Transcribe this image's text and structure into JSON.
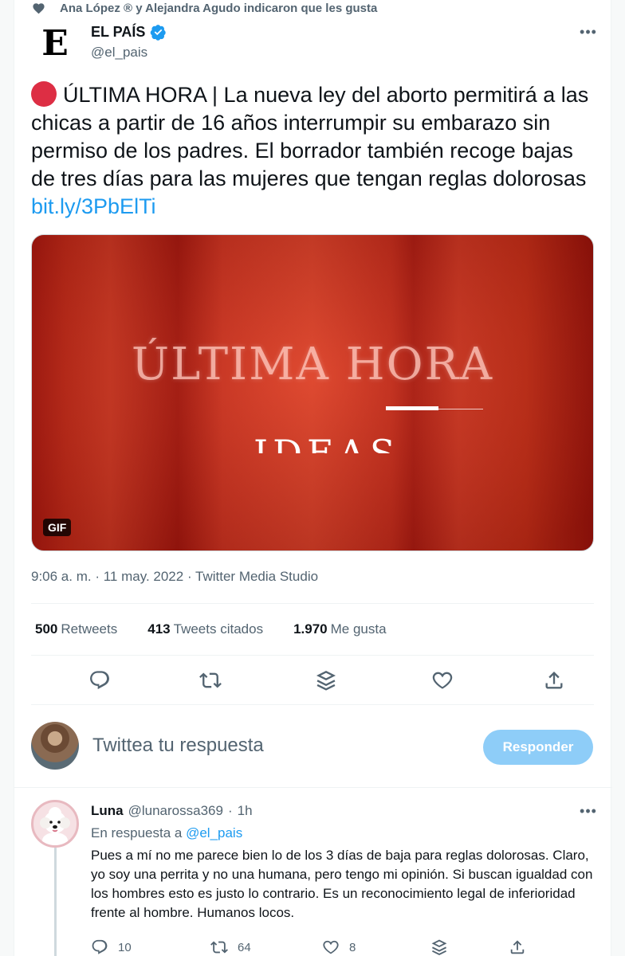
{
  "social_context": {
    "text": "Ana López ® y Alejandra Agudo indicaron que les gusta"
  },
  "tweet": {
    "avatar_letter": "E",
    "author_name": "EL PAÍS",
    "author_handle": "@el_pais",
    "more_icon": "•••",
    "text": "ÚLTIMA HORA | La nueva ley del aborto permitirá a las chicas a partir de 16 años interrumpir su embarazo sin permiso de los padres. El borrador también recoge bajas de tres días para las mujeres que tengan reglas dolorosas ",
    "link": "bit.ly/3PbElTi",
    "media": {
      "title": "ÚLTIMA HORA",
      "subtitle_fragment": "IDEAS",
      "badge": "GIF"
    },
    "time": "9:06 a. m.",
    "date": "11 may. 2022",
    "source": "Twitter Media Studio",
    "separator": " · "
  },
  "stats": {
    "retweets_count": "500",
    "retweets_label": "Retweets",
    "quotes_count": "413",
    "quotes_label": "Tweets citados",
    "likes_count": "1.970",
    "likes_label": "Me gusta"
  },
  "reply_box": {
    "placeholder": "Twittea tu respuesta",
    "button": "Responder"
  },
  "reply": {
    "name": "Luna",
    "handle": "@lunarossa369",
    "separator": "·",
    "time": "1h",
    "more_icon": "•••",
    "reply_prefix": "En respuesta a ",
    "reply_to": "@el_pais",
    "text": "Pues a mí no me parece bien lo de los 3 días de baja para reglas dolorosas. Claro, yo soy una perrita y no una humana, pero tengo mi opinión. Si buscan igualdad con los hombres esto es justo lo contrario. Es un reconocimiento legal de inferioridad frente al hombre. Humanos locos.",
    "replies": "10",
    "retweets": "64",
    "likes": "8"
  },
  "colors": {
    "accent": "#1d9bf0",
    "secondary_text": "#536471",
    "breaking_dot": "#dd2e44",
    "media_red": "#c82d1a",
    "reply_button_disabled": "#8ecdf8"
  },
  "icons": [
    "heart-icon",
    "verified-badge-icon",
    "more-icon",
    "reply-icon",
    "retweet-icon",
    "stack-icon",
    "like-icon",
    "share-icon"
  ]
}
